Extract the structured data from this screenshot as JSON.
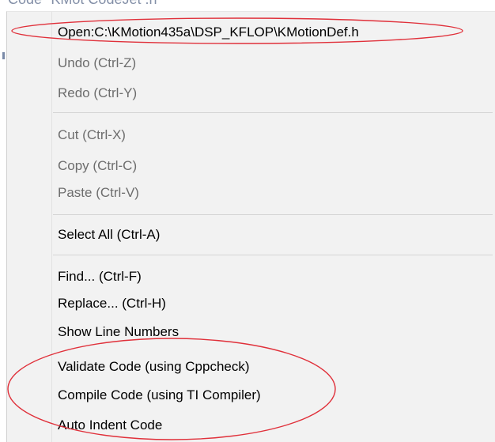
{
  "background_code": {
    "text": "Code   \"KMot CodeJet  .h\""
  },
  "annotation_color": "#e0303a",
  "context_menu": {
    "items": [
      {
        "label": "Open:C:\\KMotion435a\\DSP_KFLOP\\KMotionDef.h",
        "enabled": true
      },
      {
        "label": "Undo (Ctrl-Z)",
        "enabled": false
      },
      {
        "label": "Redo (Ctrl-Y)",
        "enabled": false
      },
      {
        "label": "Cut (Ctrl-X)",
        "enabled": false
      },
      {
        "label": "Copy (Ctrl-C)",
        "enabled": false
      },
      {
        "label": "Paste (Ctrl-V)",
        "enabled": false
      },
      {
        "label": "Select All (Ctrl-A)",
        "enabled": true
      },
      {
        "label": "Find... (Ctrl-F)",
        "enabled": true
      },
      {
        "label": "Replace... (Ctrl-H)",
        "enabled": true
      },
      {
        "label": "Show Line Numbers",
        "enabled": true
      },
      {
        "label": "Validate Code (using Cppcheck)",
        "enabled": true
      },
      {
        "label": "Compile Code (using TI Compiler)",
        "enabled": true
      },
      {
        "label": "Auto Indent Code",
        "enabled": true
      }
    ]
  }
}
